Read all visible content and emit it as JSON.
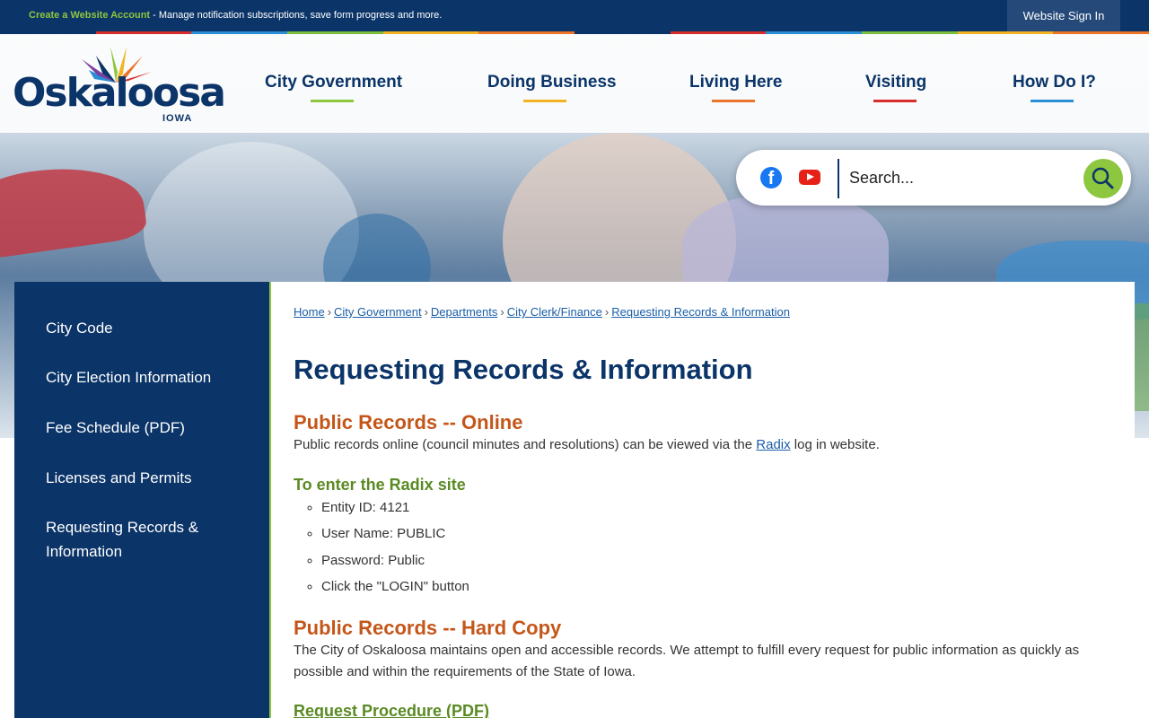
{
  "topbar": {
    "create_link": "Create a Website Account",
    "create_text": " - Manage notification subscriptions, save form progress and more.",
    "signin": "Website Sign In",
    "stripe_colors": [
      "#0b3468",
      "#d92c2c",
      "#2a8fd6",
      "#7bbd3d",
      "#f2b321",
      "#e9742a"
    ]
  },
  "logo": {
    "name": "Oskaloosa",
    "state": "IOWA"
  },
  "nav": [
    {
      "label": "City Government",
      "underline": "#8dc63f"
    },
    {
      "label": "Doing Business",
      "underline": "#f2b321"
    },
    {
      "label": "Living Here",
      "underline": "#e9742a"
    },
    {
      "label": "Visiting",
      "underline": "#d92c2c"
    },
    {
      "label": "How Do I?",
      "underline": "#2a8fd6"
    }
  ],
  "search": {
    "placeholder": "Search...",
    "facebook_icon": "facebook-icon",
    "youtube_icon": "youtube-icon",
    "search_icon": "magnifier-icon"
  },
  "sidebar": {
    "items": [
      {
        "label": "City Code"
      },
      {
        "label": "City Election Information"
      },
      {
        "label": "Fee Schedule (PDF)"
      },
      {
        "label": "Licenses and Permits"
      },
      {
        "label": "Requesting Records & Information"
      }
    ]
  },
  "breadcrumb": [
    "Home",
    "City Government",
    "Departments",
    "City Clerk/Finance",
    "Requesting Records & Information"
  ],
  "breadcrumb_separator": "›",
  "main": {
    "title": "Requesting Records & Information",
    "online_heading": "Public Records -- Online",
    "online_text_before": "Public records online (council minutes and resolutions) can be viewed via the ",
    "online_link": "Radix",
    "online_text_after": " log in website.",
    "radix_heading": "To enter the Radix site",
    "radix_items": [
      "Entity ID: 4121",
      "User Name: PUBLIC",
      "Password: Public",
      "Click the \"LOGIN\" button"
    ],
    "hardcopy_heading": "Public Records -- Hard Copy",
    "hardcopy_text": "The City of Oskaloosa maintains open and accessible records. We attempt to fulfill every request for public information as quickly as possible and within the requirements of the State of Iowa.",
    "request_link": "Request Procedure (PDF)"
  }
}
